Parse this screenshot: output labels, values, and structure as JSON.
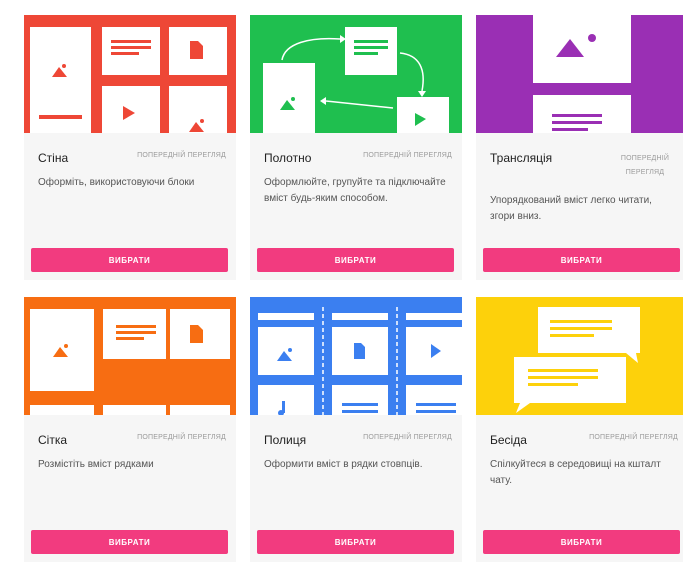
{
  "colors": {
    "wall": "#ee4736",
    "canvas": "#1fbf4f",
    "stream": "#9a2fb4",
    "grid": "#f76d12",
    "shelf": "#3b7ff0",
    "chat": "#fdd10b",
    "button": "#f23b7f"
  },
  "cards": [
    {
      "title": "Стіна",
      "preview": "ПОПЕРЕДНІЙ ПЕРЕГЛЯД",
      "description": "Оформіть, використовуючи блоки",
      "button": "ВИБРАТИ",
      "icon": "wall-layout-icon"
    },
    {
      "title": "Полотно",
      "preview": "ПОПЕРЕДНІЙ ПЕРЕГЛЯД",
      "description": "Оформлюйте, групуйте та підключайте вміст будь-яким способом.",
      "button": "ВИБРАТИ",
      "icon": "canvas-layout-icon"
    },
    {
      "title": "Трансляція",
      "preview": "ПОПЕРЕДНІЙ ПЕРЕГЛЯД",
      "description": "Упорядкований вміст легко читати, згори вниз.",
      "button": "ВИБРАТИ",
      "icon": "stream-layout-icon"
    },
    {
      "title": "Сітка",
      "preview": "ПОПЕРЕДНІЙ ПЕРЕГЛЯД",
      "description": "Розмістіть вміст рядками",
      "button": "ВИБРАТИ",
      "icon": "grid-layout-icon"
    },
    {
      "title": "Полиця",
      "preview": "ПОПЕРЕДНІЙ ПЕРЕГЛЯД",
      "description": "Оформити вміст в рядки стовпців.",
      "button": "ВИБРАТИ",
      "icon": "shelf-layout-icon"
    },
    {
      "title": "Бесіда",
      "preview": "ПОПЕРЕДНІЙ ПЕРЕГЛЯД",
      "description": "Спілкуйтеся в середовищі на кшталт чату.",
      "button": "ВИБРАТИ",
      "icon": "chat-layout-icon"
    }
  ]
}
